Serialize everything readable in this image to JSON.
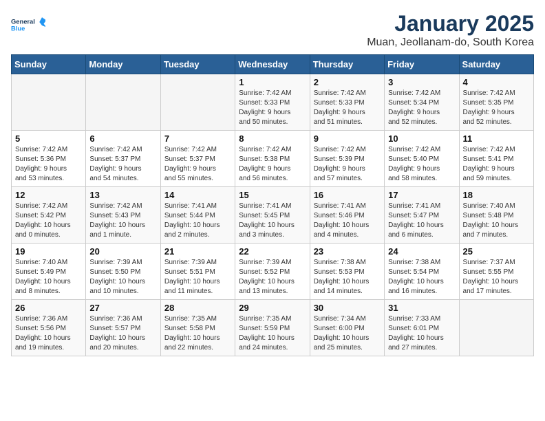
{
  "header": {
    "logo_general": "General",
    "logo_blue": "Blue",
    "month_title": "January 2025",
    "location": "Muan, Jeollanam-do, South Korea"
  },
  "days_of_week": [
    "Sunday",
    "Monday",
    "Tuesday",
    "Wednesday",
    "Thursday",
    "Friday",
    "Saturday"
  ],
  "weeks": [
    [
      {
        "day": "",
        "info": ""
      },
      {
        "day": "",
        "info": ""
      },
      {
        "day": "",
        "info": ""
      },
      {
        "day": "1",
        "info": "Sunrise: 7:42 AM\nSunset: 5:33 PM\nDaylight: 9 hours\nand 50 minutes."
      },
      {
        "day": "2",
        "info": "Sunrise: 7:42 AM\nSunset: 5:33 PM\nDaylight: 9 hours\nand 51 minutes."
      },
      {
        "day": "3",
        "info": "Sunrise: 7:42 AM\nSunset: 5:34 PM\nDaylight: 9 hours\nand 52 minutes."
      },
      {
        "day": "4",
        "info": "Sunrise: 7:42 AM\nSunset: 5:35 PM\nDaylight: 9 hours\nand 52 minutes."
      }
    ],
    [
      {
        "day": "5",
        "info": "Sunrise: 7:42 AM\nSunset: 5:36 PM\nDaylight: 9 hours\nand 53 minutes."
      },
      {
        "day": "6",
        "info": "Sunrise: 7:42 AM\nSunset: 5:37 PM\nDaylight: 9 hours\nand 54 minutes."
      },
      {
        "day": "7",
        "info": "Sunrise: 7:42 AM\nSunset: 5:37 PM\nDaylight: 9 hours\nand 55 minutes."
      },
      {
        "day": "8",
        "info": "Sunrise: 7:42 AM\nSunset: 5:38 PM\nDaylight: 9 hours\nand 56 minutes."
      },
      {
        "day": "9",
        "info": "Sunrise: 7:42 AM\nSunset: 5:39 PM\nDaylight: 9 hours\nand 57 minutes."
      },
      {
        "day": "10",
        "info": "Sunrise: 7:42 AM\nSunset: 5:40 PM\nDaylight: 9 hours\nand 58 minutes."
      },
      {
        "day": "11",
        "info": "Sunrise: 7:42 AM\nSunset: 5:41 PM\nDaylight: 9 hours\nand 59 minutes."
      }
    ],
    [
      {
        "day": "12",
        "info": "Sunrise: 7:42 AM\nSunset: 5:42 PM\nDaylight: 10 hours\nand 0 minutes."
      },
      {
        "day": "13",
        "info": "Sunrise: 7:42 AM\nSunset: 5:43 PM\nDaylight: 10 hours\nand 1 minute."
      },
      {
        "day": "14",
        "info": "Sunrise: 7:41 AM\nSunset: 5:44 PM\nDaylight: 10 hours\nand 2 minutes."
      },
      {
        "day": "15",
        "info": "Sunrise: 7:41 AM\nSunset: 5:45 PM\nDaylight: 10 hours\nand 3 minutes."
      },
      {
        "day": "16",
        "info": "Sunrise: 7:41 AM\nSunset: 5:46 PM\nDaylight: 10 hours\nand 4 minutes."
      },
      {
        "day": "17",
        "info": "Sunrise: 7:41 AM\nSunset: 5:47 PM\nDaylight: 10 hours\nand 6 minutes."
      },
      {
        "day": "18",
        "info": "Sunrise: 7:40 AM\nSunset: 5:48 PM\nDaylight: 10 hours\nand 7 minutes."
      }
    ],
    [
      {
        "day": "19",
        "info": "Sunrise: 7:40 AM\nSunset: 5:49 PM\nDaylight: 10 hours\nand 8 minutes."
      },
      {
        "day": "20",
        "info": "Sunrise: 7:39 AM\nSunset: 5:50 PM\nDaylight: 10 hours\nand 10 minutes."
      },
      {
        "day": "21",
        "info": "Sunrise: 7:39 AM\nSunset: 5:51 PM\nDaylight: 10 hours\nand 11 minutes."
      },
      {
        "day": "22",
        "info": "Sunrise: 7:39 AM\nSunset: 5:52 PM\nDaylight: 10 hours\nand 13 minutes."
      },
      {
        "day": "23",
        "info": "Sunrise: 7:38 AM\nSunset: 5:53 PM\nDaylight: 10 hours\nand 14 minutes."
      },
      {
        "day": "24",
        "info": "Sunrise: 7:38 AM\nSunset: 5:54 PM\nDaylight: 10 hours\nand 16 minutes."
      },
      {
        "day": "25",
        "info": "Sunrise: 7:37 AM\nSunset: 5:55 PM\nDaylight: 10 hours\nand 17 minutes."
      }
    ],
    [
      {
        "day": "26",
        "info": "Sunrise: 7:36 AM\nSunset: 5:56 PM\nDaylight: 10 hours\nand 19 minutes."
      },
      {
        "day": "27",
        "info": "Sunrise: 7:36 AM\nSunset: 5:57 PM\nDaylight: 10 hours\nand 20 minutes."
      },
      {
        "day": "28",
        "info": "Sunrise: 7:35 AM\nSunset: 5:58 PM\nDaylight: 10 hours\nand 22 minutes."
      },
      {
        "day": "29",
        "info": "Sunrise: 7:35 AM\nSunset: 5:59 PM\nDaylight: 10 hours\nand 24 minutes."
      },
      {
        "day": "30",
        "info": "Sunrise: 7:34 AM\nSunset: 6:00 PM\nDaylight: 10 hours\nand 25 minutes."
      },
      {
        "day": "31",
        "info": "Sunrise: 7:33 AM\nSunset: 6:01 PM\nDaylight: 10 hours\nand 27 minutes."
      },
      {
        "day": "",
        "info": ""
      }
    ]
  ]
}
